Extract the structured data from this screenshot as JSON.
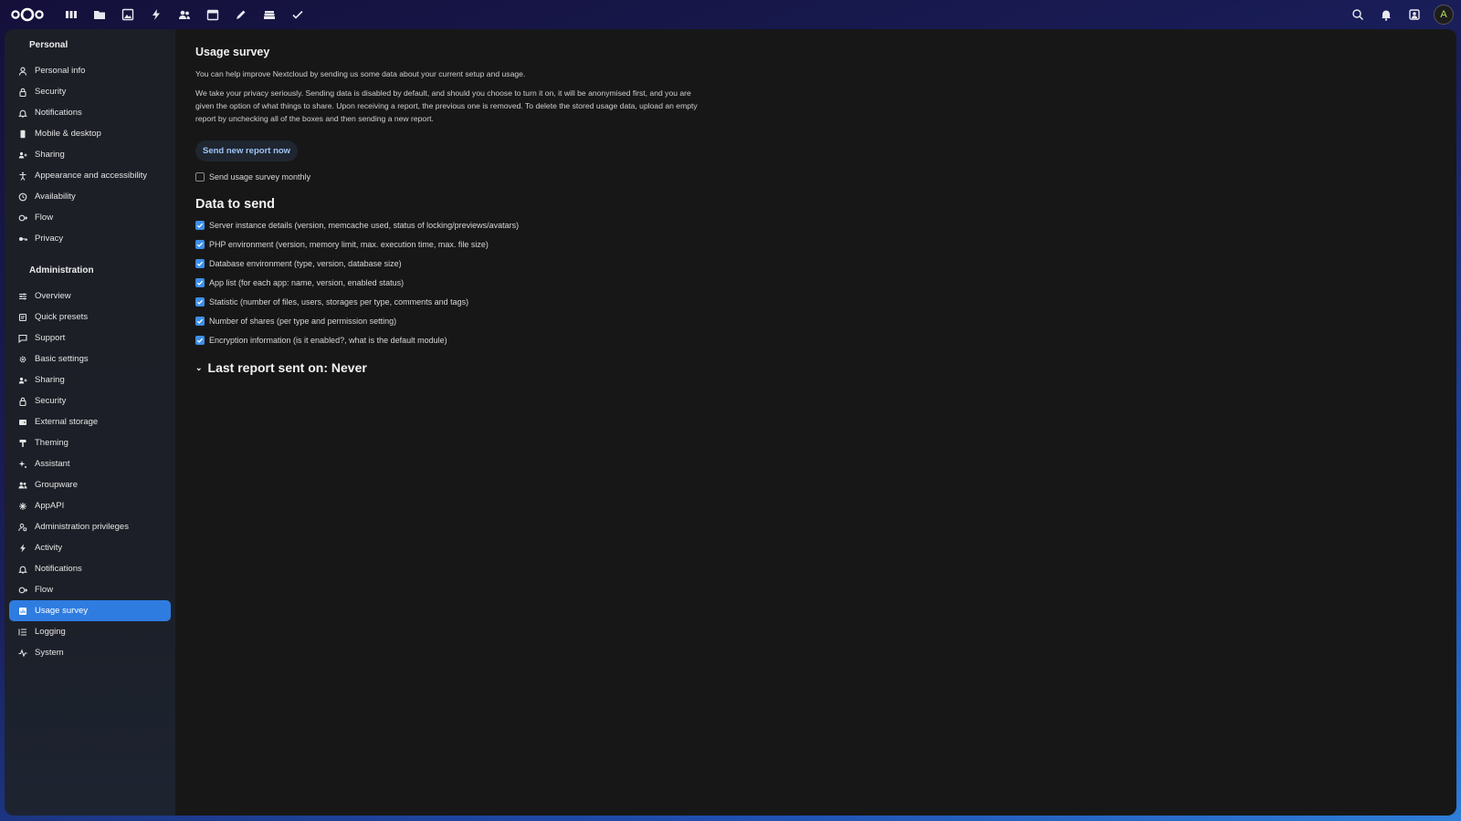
{
  "header": {
    "logo": "nextcloud-logo",
    "apps": [
      "dashboard-icon",
      "files-icon",
      "photos-icon",
      "activity-icon",
      "contacts-icon",
      "calendar-icon",
      "notes-icon",
      "deck-icon",
      "tasks-icon"
    ],
    "right": [
      "search-icon",
      "notifications-icon",
      "contacts-menu-icon"
    ],
    "avatar_letter": "A"
  },
  "sidebar": {
    "personal_title": "Personal",
    "personal_items": [
      {
        "label": "Personal info",
        "icon": "user-icon"
      },
      {
        "label": "Security",
        "icon": "lock-icon"
      },
      {
        "label": "Notifications",
        "icon": "bell-icon"
      },
      {
        "label": "Mobile & desktop",
        "icon": "phone-icon"
      },
      {
        "label": "Sharing",
        "icon": "share-icon"
      },
      {
        "label": "Appearance and accessibility",
        "icon": "accessibility-icon"
      },
      {
        "label": "Availability",
        "icon": "clock-icon"
      },
      {
        "label": "Flow",
        "icon": "flow-icon"
      },
      {
        "label": "Privacy",
        "icon": "key-icon"
      }
    ],
    "admin_title": "Administration",
    "admin_items": [
      {
        "label": "Overview",
        "icon": "sliders-icon"
      },
      {
        "label": "Quick presets",
        "icon": "presets-icon"
      },
      {
        "label": "Support",
        "icon": "chat-icon"
      },
      {
        "label": "Basic settings",
        "icon": "gear-icon"
      },
      {
        "label": "Sharing",
        "icon": "share-icon"
      },
      {
        "label": "Security",
        "icon": "lock-icon"
      },
      {
        "label": "External storage",
        "icon": "storage-icon"
      },
      {
        "label": "Theming",
        "icon": "brush-icon"
      },
      {
        "label": "Assistant",
        "icon": "sparkle-icon"
      },
      {
        "label": "Groupware",
        "icon": "group-icon"
      },
      {
        "label": "AppAPI",
        "icon": "api-icon"
      },
      {
        "label": "Administration privileges",
        "icon": "admin-user-icon"
      },
      {
        "label": "Activity",
        "icon": "bolt-icon"
      },
      {
        "label": "Notifications",
        "icon": "bell-icon"
      },
      {
        "label": "Flow",
        "icon": "flow-icon"
      },
      {
        "label": "Usage survey",
        "icon": "survey-icon",
        "active": true
      },
      {
        "label": "Logging",
        "icon": "list-icon"
      },
      {
        "label": "System",
        "icon": "pulse-icon"
      }
    ]
  },
  "main": {
    "title": "Usage survey",
    "intro": "You can help improve Nextcloud by sending us some data about your current setup and usage.",
    "privacy": "We take your privacy seriously. Sending data is disabled by default, and should you choose to turn it on, it will be anonymised first, and you are given the option of what things to share. Upon receiving a report, the previous one is removed. To delete the stored usage data, upload an empty report by unchecking all of the boxes and then sending a new report.",
    "send_button": "Send new report now",
    "monthly_label": "Send usage survey monthly",
    "monthly_checked": false,
    "data_title": "Data to send",
    "data_items": [
      "Server instance details (version, memcache used, status of locking/previews/avatars)",
      "PHP environment (version, memory limit, max. execution time, max. file size)",
      "Database environment (type, version, database size)",
      "App list (for each app: name, version, enabled status)",
      "Statistic (number of files, users, storages per type, comments and tags)",
      "Number of shares (per type and permission setting)",
      "Encryption information (is it enabled?, what is the default module)"
    ],
    "last_report": "Last report sent on: Never"
  },
  "colors": {
    "accent": "#2f7ce0",
    "checkbox": "#3d8fe8",
    "content_bg": "#171717",
    "sidebar_bg": "#1c1f26"
  }
}
